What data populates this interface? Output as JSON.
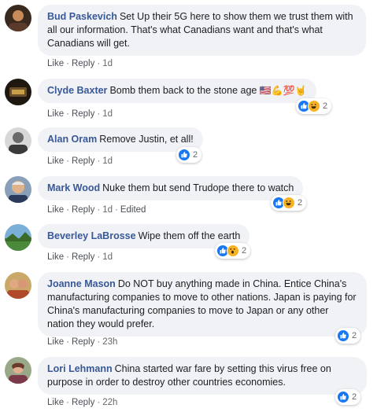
{
  "actions": {
    "like": "Like",
    "reply": "Reply",
    "separator": "·"
  },
  "comments": [
    {
      "author": "Bud Paskevich",
      "text": "Set Up their 5G here to show them we trust them with all our information. That's what Canadians want and that's what Canadians will get.",
      "time": "1d",
      "edited": "",
      "reaction_count": "",
      "avatar_color": "#5a3a2a"
    },
    {
      "author": "Clyde Baxter",
      "text": "Bomb them back to the stone age",
      "emojis": "🇺🇸💪💯🤘",
      "time": "1d",
      "edited": "",
      "reaction_count": "2",
      "reactions": [
        "like",
        "haha"
      ],
      "avatar_color": "#2b2219"
    },
    {
      "author": "Alan Oram",
      "text": "Remove Justin, et all!",
      "time": "1d",
      "edited": "",
      "reaction_count": "2",
      "reactions": [
        "like"
      ],
      "avatar_color": "#8a8a8a"
    },
    {
      "author": "Mark Wood",
      "text": "Nuke them but send Trudope there to watch",
      "time": "1d",
      "edited": "Edited",
      "reaction_count": "2",
      "reactions": [
        "like",
        "haha"
      ],
      "avatar_color": "#c9a07a"
    },
    {
      "author": "Beverley LaBrosse",
      "text": "Wipe them off the earth",
      "time": "1d",
      "edited": "",
      "reaction_count": "2",
      "reactions": [
        "like",
        "wow"
      ],
      "avatar_color": "#4a8a4a"
    },
    {
      "author": "Joanne Mason",
      "text": "Do NOT buy anything made in China. Entice China's manufacturing companies to move to other nations. Japan is paying for China's manufacturing companies to move to Japan or any other nation they would prefer.",
      "time": "23h",
      "edited": "",
      "reaction_count": "2",
      "reactions": [
        "like"
      ],
      "avatar_color": "#b05a3a"
    },
    {
      "author": "Lori Lehmann",
      "text": "China started war fare by setting this virus free on purpose in order to destroy other countries economies.",
      "time": "22h",
      "edited": "",
      "reaction_count": "2",
      "reactions": [
        "like"
      ],
      "avatar_color": "#7a5a4a"
    }
  ]
}
